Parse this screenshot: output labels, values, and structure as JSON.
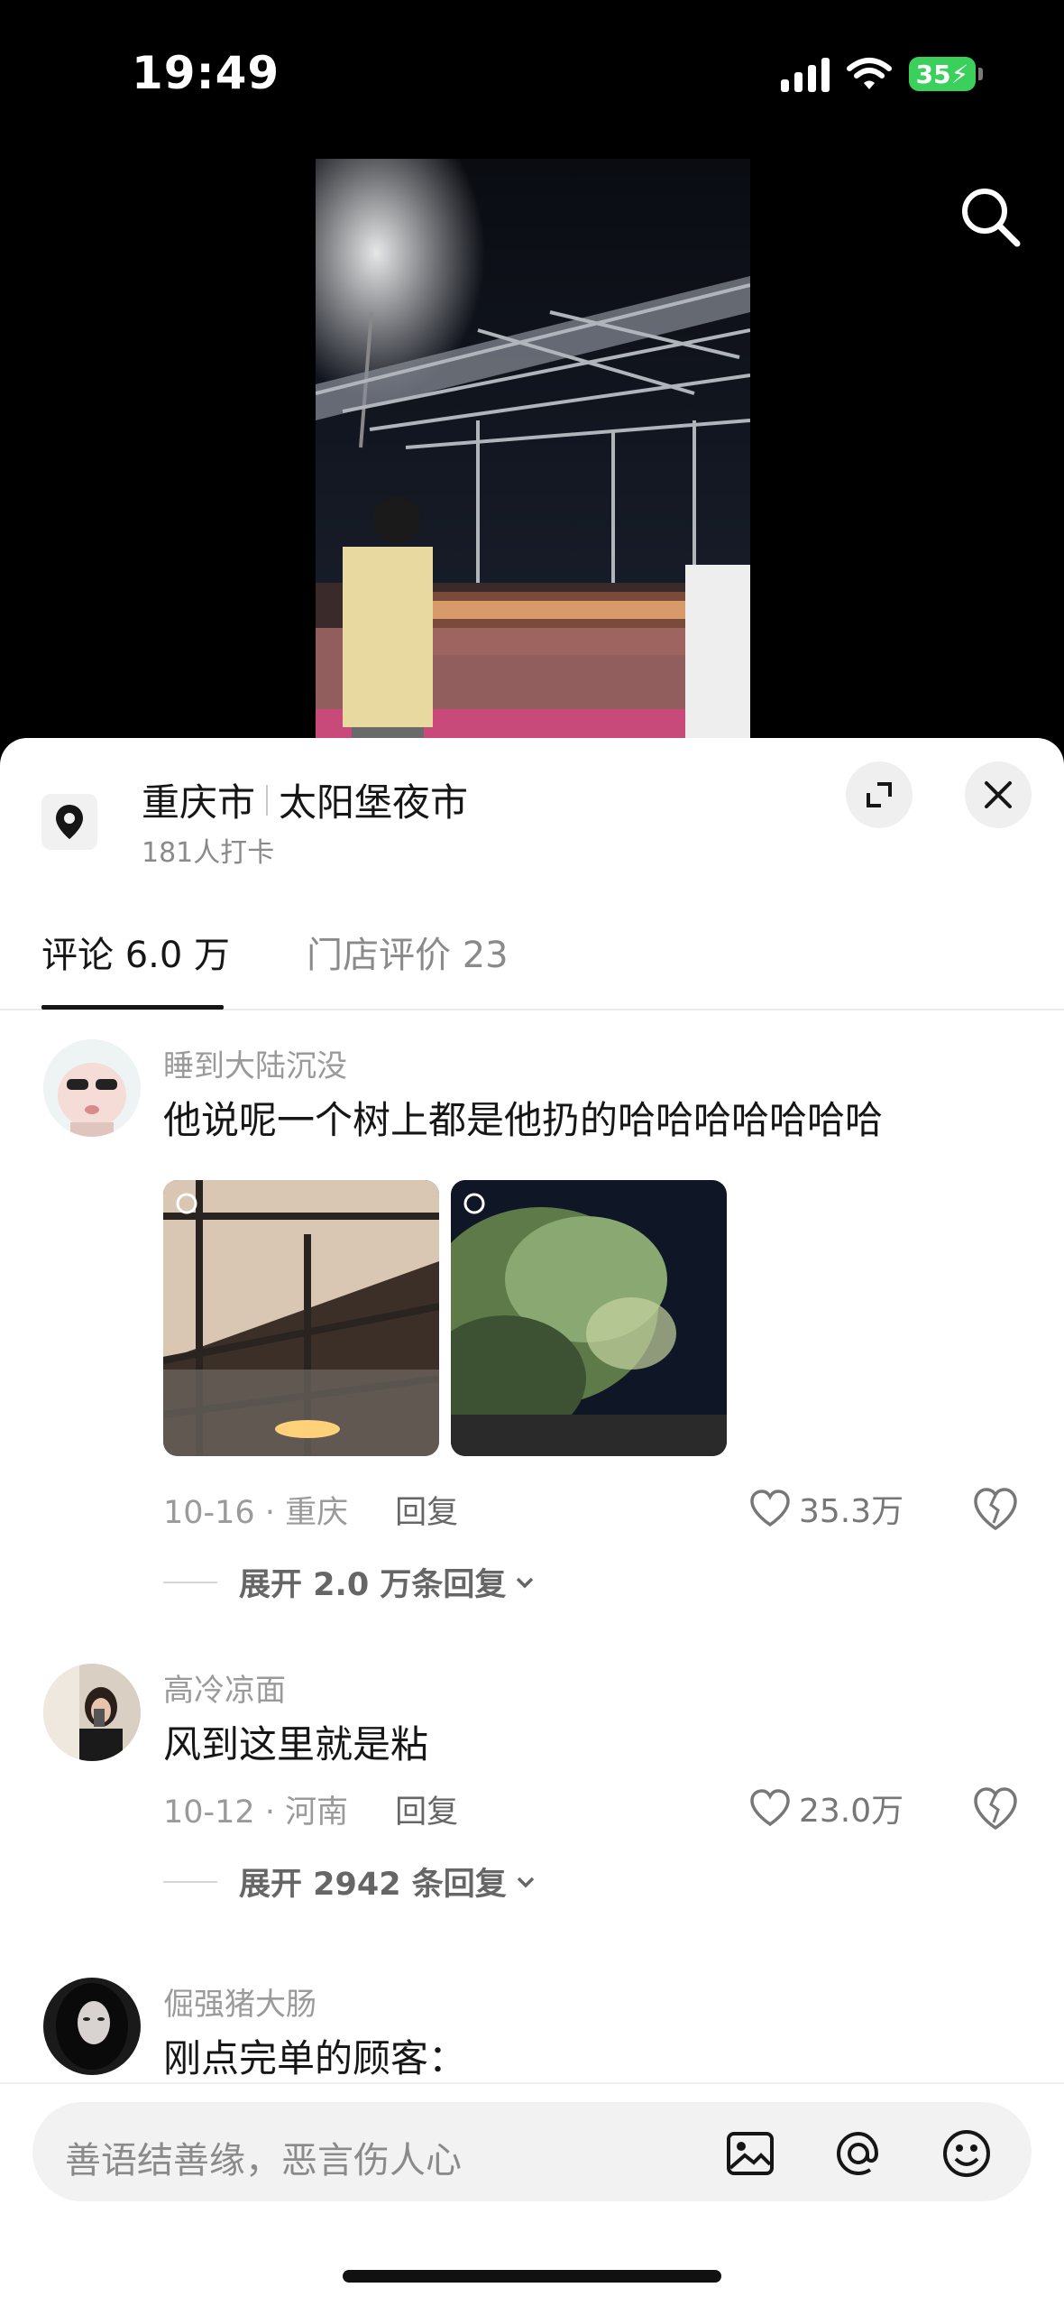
{
  "status_bar": {
    "time": "19:49",
    "battery": "35"
  },
  "location": {
    "city": "重庆市",
    "place": "太阳堡夜市",
    "checkins": "181人打卡"
  },
  "tabs": {
    "comments": "评论 6.0 万",
    "reviews": "门店评价 23"
  },
  "comments": [
    {
      "user": "睡到大陆沉没",
      "text": "他说呢一个树上都是他扔的哈哈哈哈哈哈哈",
      "date": "10-16 · 重庆",
      "reply": "回复",
      "likes": "35.3万",
      "expand": "展开 2.0 万条回复"
    },
    {
      "user": "高冷凉面",
      "text": "风到这里就是粘",
      "date": "10-12 · 河南",
      "reply": "回复",
      "likes": "23.0万",
      "expand": "展开 2942 条回复"
    },
    {
      "user": "倔强猪大肠",
      "text": "刚点完单的顾客："
    }
  ],
  "input": {
    "placeholder": "善语结善缘，恶言伤人心"
  },
  "icons": [
    "search-icon",
    "location-pin-icon",
    "expand-icon",
    "close-icon",
    "heart-icon",
    "broken-heart-icon",
    "image-icon",
    "at-icon",
    "emoji-icon",
    "chevron-down-icon"
  ]
}
